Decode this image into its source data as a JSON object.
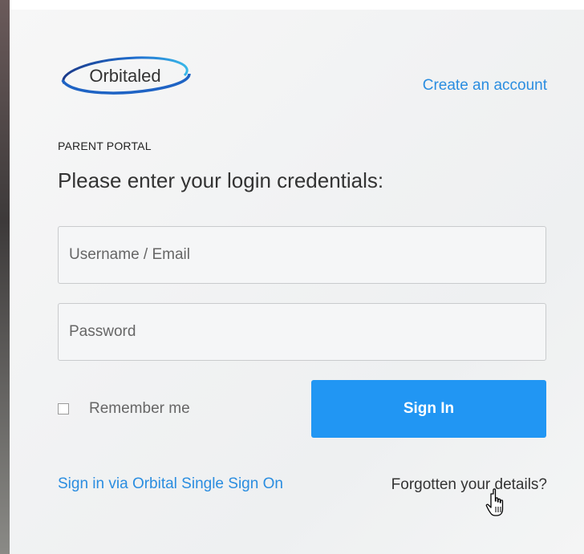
{
  "brand": {
    "logo_text": "Orbitaled"
  },
  "header": {
    "create_account_label": "Create an account"
  },
  "form": {
    "portal_label": "PARENT PORTAL",
    "heading": "Please enter your login credentials:",
    "username": {
      "placeholder": "Username / Email",
      "value": ""
    },
    "password": {
      "placeholder": "Password",
      "value": ""
    },
    "remember_label": "Remember me",
    "remember_checked": false,
    "sign_in_label": "Sign In"
  },
  "footer": {
    "sso_label": "Sign in via Orbital Single Sign On",
    "forgot_label": "Forgotten your details?"
  },
  "colors": {
    "accent": "#2196f3",
    "link": "#2a8de0"
  },
  "icons": {
    "cursor": "hand-pointer-icon"
  }
}
